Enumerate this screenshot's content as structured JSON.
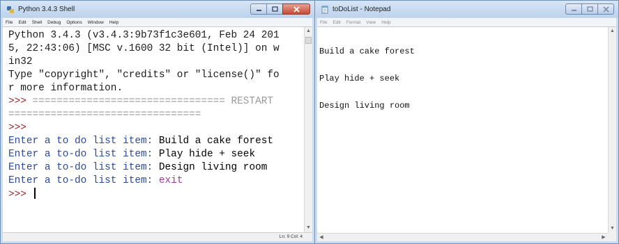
{
  "shell": {
    "title": "Python 3.4.3 Shell",
    "menu": [
      "File",
      "Edit",
      "Shell",
      "Debug",
      "Options",
      "Window",
      "Help"
    ],
    "lines": [
      [
        {
          "t": "Python 3.4.3 (v3.4.3:9b73f1c3e601, Feb 24 201",
          "c": "c-output"
        }
      ],
      [
        {
          "t": "5, 22:43:06) [MSC v.1600 32 bit (Intel)] on w",
          "c": "c-output"
        }
      ],
      [
        {
          "t": "in32",
          "c": "c-output"
        }
      ],
      [
        {
          "t": "Type \"copyright\", \"credits\" or \"license()\" fo",
          "c": "c-output"
        }
      ],
      [
        {
          "t": "r more information.",
          "c": "c-output"
        }
      ],
      [
        {
          "t": ">>> ",
          "c": "c-prompt"
        },
        {
          "t": "================================ RESTART",
          "c": "c-restart"
        }
      ],
      [
        {
          "t": "================================",
          "c": "c-restart"
        }
      ],
      [
        {
          "t": ">>>",
          "c": "c-prompt"
        }
      ],
      [
        {
          "t": "Enter a to do list item: ",
          "c": "c-stdout"
        },
        {
          "t": "Build a cake forest",
          "c": "c-input"
        }
      ],
      [
        {
          "t": "Enter a to-do list item: ",
          "c": "c-stdout"
        },
        {
          "t": "Play hide + seek",
          "c": "c-input"
        }
      ],
      [
        {
          "t": "Enter a to-do list item: ",
          "c": "c-stdout"
        },
        {
          "t": "Design living room",
          "c": "c-input"
        }
      ],
      [
        {
          "t": "Enter a to-do list item: ",
          "c": "c-stdout"
        },
        {
          "t": "exit",
          "c": "c-exit"
        }
      ],
      [
        {
          "t": ">>> ",
          "c": "c-prompt"
        }
      ]
    ],
    "status": "Ln: 9 Col: 4",
    "colors": {
      "prompt": "#a0202a",
      "stdout": "#2a4aa0",
      "exit": "#a03aa0"
    }
  },
  "notepad": {
    "title": "toDoList - Notepad",
    "menu": [
      "File",
      "Edit",
      "Format",
      "View",
      "Help"
    ],
    "lines": [
      "Build a cake forest",
      "Play hide + seek",
      "Design living room"
    ]
  },
  "icons": {
    "python_app": "python-logo-icon",
    "notepad_app": "notepad-icon",
    "minimize": "minimize-icon",
    "maximize": "maximize-icon",
    "close": "close-icon"
  }
}
